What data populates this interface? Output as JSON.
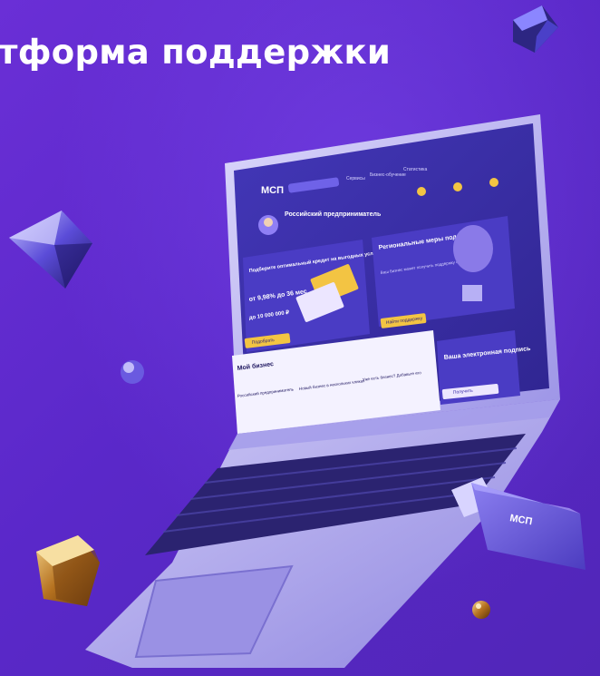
{
  "headline": "тформа поддержки",
  "laptop_screen": {
    "logo": "МСП",
    "nav_items": [
      "Сервисы",
      "Бизнес-обучение",
      "Статистика"
    ],
    "profile_title": "Российский предприниматель",
    "credit_card": {
      "title": "Подберите оптимальный кредит на выгодных условиях!",
      "rate": "от 9,98% до 36 мес",
      "amount": "до 10 000 000 ₽",
      "button": "Подобрать"
    },
    "support_card": {
      "title": "Региональные меры поддержки",
      "subtitle": "Ваш бизнес может получить поддержку от государства",
      "button": "Найти поддержку"
    },
    "signature_card": {
      "title": "Ваша электронная подпись",
      "button": "Получить"
    },
    "my_business": {
      "title": "Мой бизнес",
      "col1": "Российский предприниматель",
      "col2": "Новый бизнес в нескольких кликах",
      "col3": "Уже есть бизнес? Добавьте его"
    }
  },
  "usb_drive": {
    "logo": "МСП"
  },
  "colors": {
    "background": "#5a28c9",
    "screen": "#3c2fa8",
    "card_primary": "#4a3cc4",
    "accent_yellow": "#f3c443",
    "laptop_body": "#b7b2ee"
  }
}
